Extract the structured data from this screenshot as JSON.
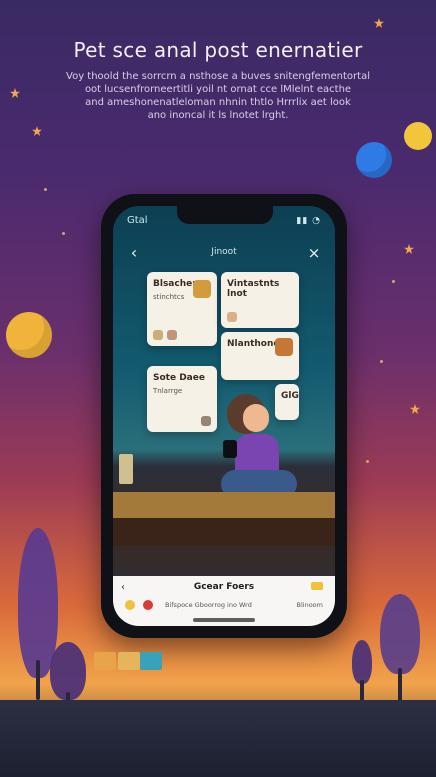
{
  "hero": {
    "title": "Pet sce anal post enernatier",
    "subtitle_lines": [
      "Voy thoold the sorrcrn a nsthose a buves snitengfementortal",
      "oot lucsenfrorneertitli yoil nt ornat cce lMlelnt eacthe",
      "and ameshonenatleloman nhnin thtlo Hrrrlix aet look",
      "ano inoncal it ls lnotet lrght."
    ]
  },
  "phone": {
    "status_time": "Gtal",
    "status_icons": "▮▮ ◔",
    "nav_title": "Jinoot",
    "bottom_title": "Gcear Foers",
    "bottom_meta_left": "Bifspoce Gboorrog ino Wrd",
    "bottom_meta_right": "Blinoom"
  },
  "cards": [
    {
      "title": "Blsachen",
      "text": "stinchtcs"
    },
    {
      "title": "Vintastnts lnot",
      "text": ""
    },
    {
      "title": "Nlanthone",
      "text": ""
    },
    {
      "title": "Sote Daee",
      "text": "Tnlarrge"
    },
    {
      "title": "GlGt",
      "text": ""
    }
  ],
  "icons": {
    "back": "‹",
    "close": "×",
    "bottom_back": "‹"
  },
  "colors": {
    "accent_yellow": "#f0c23b",
    "accent_red": "#d93a3a",
    "purple": "#7a45b1",
    "teal": "#135b70"
  }
}
